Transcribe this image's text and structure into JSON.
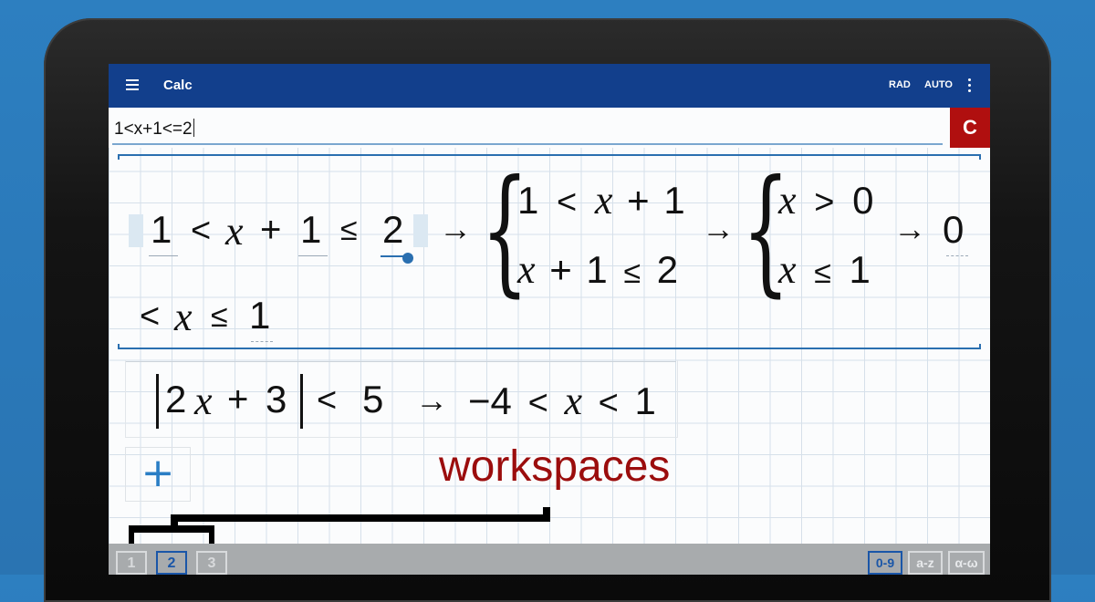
{
  "appbar": {
    "title": "Calc",
    "angle_mode": "RAD",
    "result_mode": "AUTO",
    "menu_icon": "hamburger-icon",
    "more_icon": "more-vert-icon"
  },
  "input": {
    "value": "1<x+1<=2",
    "clear_label": "C"
  },
  "expression1": {
    "lhs": [
      "1",
      "<",
      "x",
      "+",
      "1",
      "≤",
      "2"
    ],
    "arrow": "→",
    "system1": {
      "line1": [
        "1",
        "<",
        "x",
        "+",
        "1"
      ],
      "line2": [
        "x",
        "+",
        "1",
        "≤",
        "2"
      ]
    },
    "system2": {
      "line1": [
        "x",
        ">",
        "0"
      ],
      "line2": [
        "x",
        "≤",
        "1"
      ]
    },
    "result": {
      "a": "0",
      "b": "<",
      "c": "x",
      "d": "≤",
      "e": "1"
    }
  },
  "expression2": {
    "inner": [
      "2",
      "x",
      "+",
      "3"
    ],
    "rel": "<",
    "rhs": "5",
    "arrow": "→",
    "result": [
      "−4",
      "<",
      "x",
      "<",
      "1"
    ]
  },
  "add_label": "+",
  "annotation": "workspaces",
  "workspaces": [
    "1",
    "2",
    "3"
  ],
  "active_workspace": "2",
  "keyboards": [
    "0-9",
    "a-z",
    "α-ω"
  ],
  "active_keyboard": "0-9",
  "colors": {
    "appbar": "#123f8c",
    "clear": "#b00f0f",
    "annotation": "#9b0d0d",
    "accent": "#2a6fb0"
  }
}
